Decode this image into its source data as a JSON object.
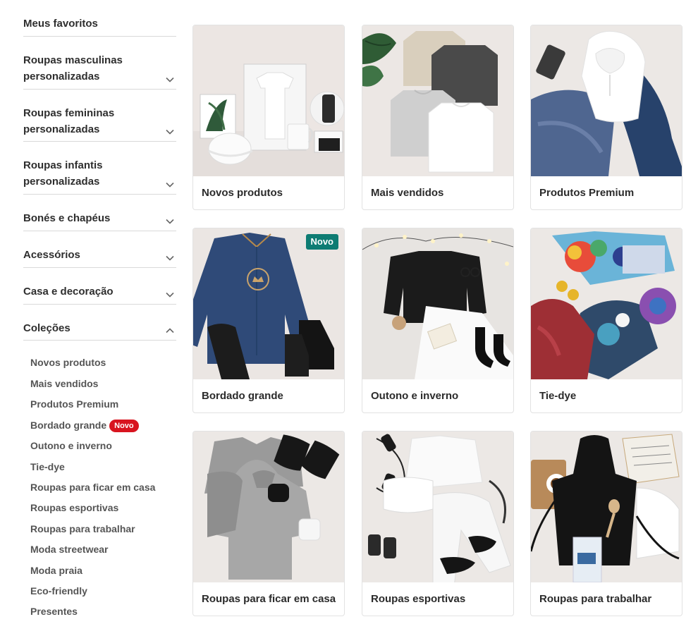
{
  "sidebar": {
    "favorites": "Meus favoritos",
    "sections": [
      {
        "label": "Roupas masculinas personalizadas"
      },
      {
        "label": "Roupas femininas personalizadas"
      },
      {
        "label": "Roupas infantis personalizadas"
      },
      {
        "label": "Bonés e chapéus"
      },
      {
        "label": "Acessórios"
      },
      {
        "label": "Casa e decoração"
      },
      {
        "label": "Coleções"
      }
    ],
    "collection_items": [
      {
        "label": "Novos produtos"
      },
      {
        "label": "Mais vendidos"
      },
      {
        "label": "Produtos Premium"
      },
      {
        "label": "Bordado grande",
        "badge": "Novo"
      },
      {
        "label": "Outono e inverno"
      },
      {
        "label": "Tie-dye"
      },
      {
        "label": "Roupas para ficar em casa"
      },
      {
        "label": "Roupas esportivas"
      },
      {
        "label": "Roupas para trabalhar"
      },
      {
        "label": "Moda streetwear"
      },
      {
        "label": "Moda praia"
      },
      {
        "label": "Eco-friendly"
      },
      {
        "label": "Presentes"
      }
    ]
  },
  "cards": [
    {
      "label": "Novos produtos"
    },
    {
      "label": "Mais vendidos"
    },
    {
      "label": "Produtos Premium"
    },
    {
      "label": "Bordado grande",
      "badge": "Novo"
    },
    {
      "label": "Outono e inverno"
    },
    {
      "label": "Tie-dye"
    },
    {
      "label": "Roupas para ficar em casa"
    },
    {
      "label": "Roupas esportivas"
    },
    {
      "label": "Roupas para trabalhar"
    }
  ],
  "colors": {
    "badge_red": "#d8141f",
    "badge_green": "#0e7c73",
    "divider": "#d9d9d9"
  },
  "icons": {
    "collapsed": "chevron-down-icon",
    "expanded": "chevron-up-icon"
  }
}
